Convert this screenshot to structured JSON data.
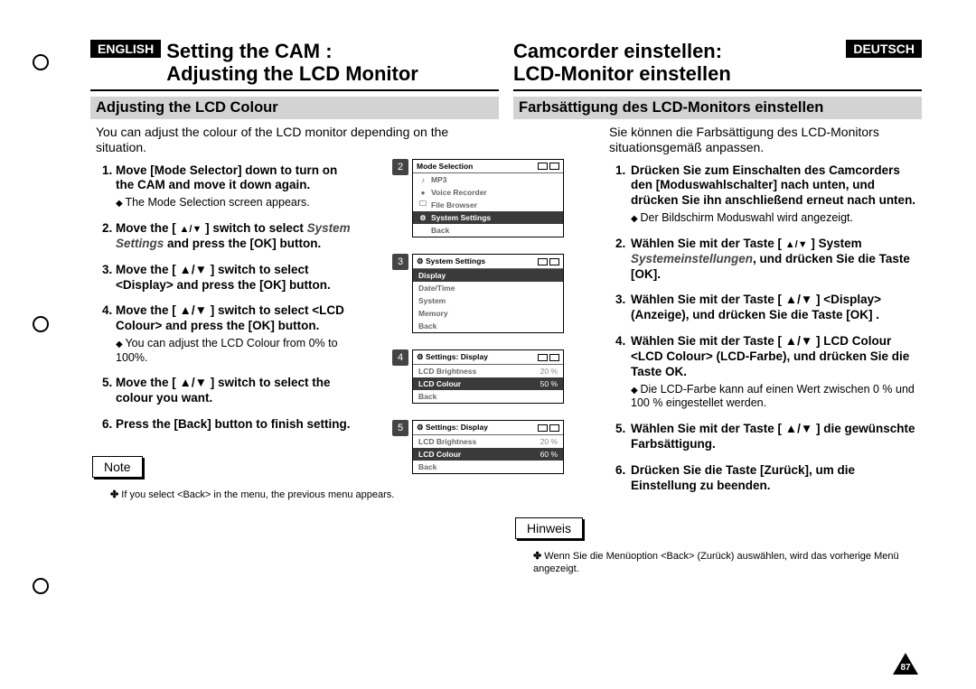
{
  "lang_en": "ENGLISH",
  "lang_de": "DEUTSCH",
  "en": {
    "title": "Setting the CAM :\nAdjusting the LCD Monitor",
    "section": "Adjusting the LCD Colour",
    "intro": "You can adjust the colour of the LCD monitor depending on the situation.",
    "steps": [
      {
        "text": "Move [Mode Selector] down to turn on the CAM and move it down again.",
        "sub": [
          "The Mode Selection screen appears."
        ]
      },
      {
        "text": "Move the [ ▲/▼ ] switch to select System Settings and press the [OK] button.",
        "em": "System Settings"
      },
      {
        "text": "Move the [ ▲/▼ ] switch to select <Display> and press the [OK] button."
      },
      {
        "text": "Move the [ ▲/▼ ] switch to select <LCD Colour> and press the [OK] button.",
        "sub": [
          "You can adjust the LCD Colour from 0% to 100%."
        ]
      },
      {
        "text": "Move the [ ▲/▼ ] switch to select the colour you want."
      },
      {
        "text": "Press the [Back] button to finish setting."
      }
    ],
    "note_label": "Note",
    "note_text": "If you select <Back> in the menu, the previous menu appears."
  },
  "de": {
    "title": "Camcorder einstellen:\nLCD-Monitor einstellen",
    "section": "Farbsättigung des LCD-Monitors einstellen",
    "intro": "Sie können die Farbsättigung des LCD-Monitors situationsgemäß anpassen.",
    "steps": [
      {
        "text": "Drücken Sie zum Einschalten des Camcorders den [Moduswahlschalter] nach unten, und drücken Sie ihn anschließend erneut nach unten.",
        "sub": [
          "Der Bildschirm Moduswahl wird angezeigt."
        ]
      },
      {
        "text": "Wählen Sie mit der Taste [ ▲/▼ ] System Systemeinstellungen, und drücken Sie die Taste [OK].",
        "em": "Systemeinstellungen"
      },
      {
        "text": "Wählen Sie mit der Taste [ ▲/▼ ] <Display> (Anzeige), und drücken Sie die Taste [OK] ."
      },
      {
        "text": "Wählen Sie mit der Taste [ ▲/▼ ] LCD Colour <LCD Colour> (LCD-Farbe), und drücken Sie die Taste OK.",
        "sub": [
          "Die LCD-Farbe kann auf einen Wert zwischen 0 % und 100 % eingestellet werden."
        ]
      },
      {
        "text": "Wählen Sie mit der Taste [ ▲/▼ ] die gewünschte Farbsättigung."
      },
      {
        "text": "Drücken Sie die Taste [Zurück], um die Einstellung zu beenden."
      }
    ],
    "note_label": "Hinweis",
    "note_text": "Wenn Sie die Menüoption <Back> (Zurück) auswählen, wird das vorherige Menü angezeigt."
  },
  "screens": [
    {
      "num": "2",
      "title": "Mode Selection",
      "items": [
        {
          "icon": "♪",
          "label": "MP3"
        },
        {
          "icon": "●",
          "label": "Voice Recorder"
        },
        {
          "icon": "🗀",
          "label": "File Browser"
        },
        {
          "icon": "⚙",
          "label": "System Settings",
          "sel": true
        },
        {
          "icon": "",
          "label": "Back"
        }
      ]
    },
    {
      "num": "3",
      "title": "System Settings",
      "items": [
        {
          "label": "Display",
          "sel": true
        },
        {
          "label": "Date/Time"
        },
        {
          "label": "System"
        },
        {
          "label": "Memory"
        },
        {
          "label": "Back"
        }
      ]
    },
    {
      "num": "4",
      "title": "Settings: Display",
      "items": [
        {
          "label": "LCD Brightness",
          "val": "20 %"
        },
        {
          "label": "LCD Colour",
          "val": "50 %",
          "sel": true
        },
        {
          "label": "Back"
        }
      ]
    },
    {
      "num": "5",
      "title": "Settings: Display",
      "items": [
        {
          "label": "LCD Brightness",
          "val": "20 %"
        },
        {
          "label": "LCD Colour",
          "val": "60 %",
          "sel": true
        },
        {
          "label": "Back"
        }
      ]
    }
  ],
  "page_number": "87"
}
